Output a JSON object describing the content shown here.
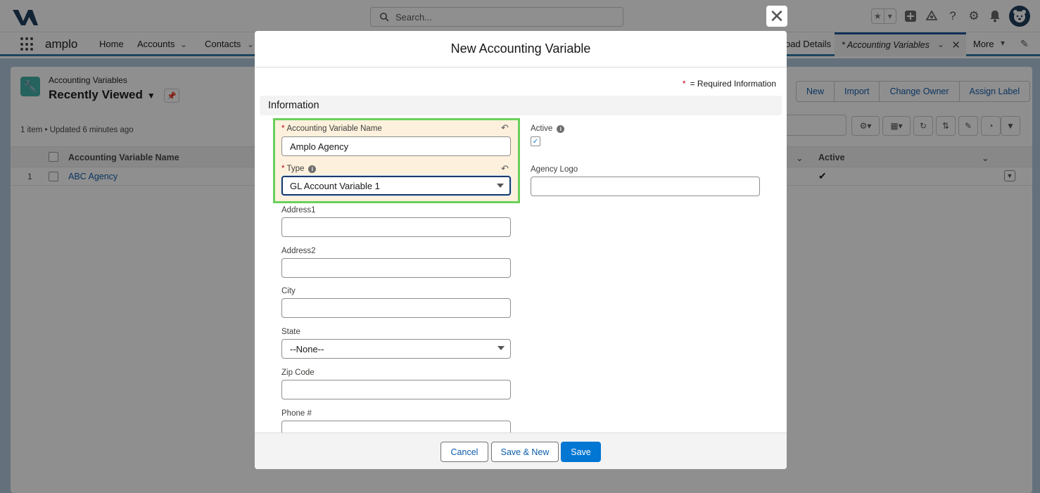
{
  "global_header": {
    "search_placeholder": "Search...",
    "avatar_initial": "●"
  },
  "nav": {
    "app_name": "amplo",
    "items": [
      {
        "label": "Home"
      },
      {
        "label": "Accounts"
      },
      {
        "label": "Contacts"
      }
    ],
    "partial_item": "oad Details",
    "active_tab": "* Accounting Variables",
    "more_label": "More"
  },
  "list_view": {
    "object_name": "Accounting Variables",
    "view_name": "Recently Viewed",
    "meta": "1 item • Updated 6 minutes ago",
    "buttons": [
      "New",
      "Import",
      "Change Owner",
      "Assign Label"
    ],
    "columns": [
      "Accounting Variable Name",
      "Active"
    ],
    "rows": [
      {
        "num": "1",
        "name": "ABC Agency"
      }
    ]
  },
  "modal": {
    "title": "New Accounting Variable",
    "required_note": "= Required Information",
    "required_star": "*",
    "section_title": "Information",
    "fields": {
      "name": {
        "label": "Accounting Variable Name",
        "value": "Amplo Agency",
        "required": true
      },
      "type": {
        "label": "Type",
        "value": "GL Account Variable 1",
        "required": true
      },
      "address1": {
        "label": "Address1",
        "value": ""
      },
      "address2": {
        "label": "Address2",
        "value": ""
      },
      "city": {
        "label": "City",
        "value": ""
      },
      "state": {
        "label": "State",
        "value": "--None--"
      },
      "zip": {
        "label": "Zip Code",
        "value": ""
      },
      "phone": {
        "label": "Phone #",
        "value": ""
      },
      "active": {
        "label": "Active",
        "checked": true
      },
      "agency_logo": {
        "label": "Agency Logo",
        "value": ""
      }
    },
    "footer": {
      "cancel": "Cancel",
      "save_new": "Save & New",
      "save": "Save"
    }
  },
  "colors": {
    "brand": "#0176d3",
    "highlight_border": "#6ad05a",
    "required": "#ba0517"
  }
}
